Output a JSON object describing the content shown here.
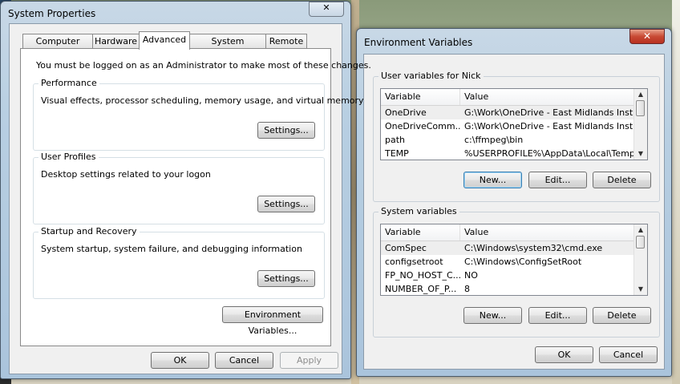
{
  "system_properties": {
    "title": "System Properties",
    "close_glyph": "✕",
    "tabs": [
      "Computer Name",
      "Hardware",
      "Advanced",
      "System Protection",
      "Remote"
    ],
    "active_tab": "Advanced",
    "admin_note": "You must be logged on as an Administrator to make most of these changes.",
    "performance": {
      "title": "Performance",
      "description": "Visual effects, processor scheduling, memory usage, and virtual memory",
      "button": "Settings..."
    },
    "user_profiles": {
      "title": "User Profiles",
      "description": "Desktop settings related to your logon",
      "button": "Settings..."
    },
    "startup_recovery": {
      "title": "Startup and Recovery",
      "description": "System startup, system failure, and debugging information",
      "button": "Settings..."
    },
    "env_button": "Environment Variables...",
    "ok": "OK",
    "cancel": "Cancel",
    "apply": "Apply"
  },
  "environment_variables": {
    "title": "Environment Variables",
    "close_glyph": "✕",
    "user_section": {
      "title": "User variables for Nick",
      "columns": [
        "Variable",
        "Value"
      ],
      "rows": [
        {
          "variable": "OneDrive",
          "value": "G:\\Work\\OneDrive - East Midlands Instr..."
        },
        {
          "variable": "OneDriveComm...",
          "value": "G:\\Work\\OneDrive - East Midlands Instr..."
        },
        {
          "variable": "path",
          "value": "c:\\ffmpeg\\bin"
        },
        {
          "variable": "TEMP",
          "value": "%USERPROFILE%\\AppData\\Local\\Temp"
        }
      ],
      "new": "New...",
      "edit": "Edit...",
      "delete": "Delete"
    },
    "system_section": {
      "title": "System variables",
      "columns": [
        "Variable",
        "Value"
      ],
      "rows": [
        {
          "variable": "ComSpec",
          "value": "C:\\Windows\\system32\\cmd.exe"
        },
        {
          "variable": "configsetroot",
          "value": "C:\\Windows\\ConfigSetRoot"
        },
        {
          "variable": "FP_NO_HOST_C...",
          "value": "NO"
        },
        {
          "variable": "NUMBER_OF_P...",
          "value": "8"
        }
      ],
      "new": "New...",
      "edit": "Edit...",
      "delete": "Delete"
    },
    "ok": "OK",
    "cancel": "Cancel"
  },
  "colors": {
    "title_bar": "#b8cfe2",
    "close_red": "#c84a34",
    "client_bg": "#f0f0f0",
    "focus_border": "#3c7fb1"
  }
}
